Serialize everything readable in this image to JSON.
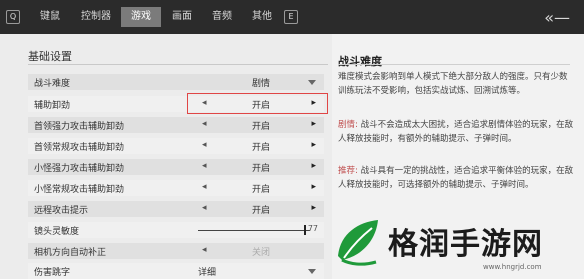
{
  "topbar": {
    "tabs": [
      {
        "label": "键鼠"
      },
      {
        "label": "控制器"
      },
      {
        "label": "游戏"
      },
      {
        "label": "画面"
      },
      {
        "label": "音频"
      },
      {
        "label": "其他"
      }
    ],
    "left_key": "Q",
    "right_key": "E"
  },
  "left": {
    "section_title": "基础设置",
    "rows": [
      {
        "label": "战斗难度",
        "value": "剧情"
      },
      {
        "label": "辅助卸劲",
        "value": "开启"
      },
      {
        "label": "首领强力攻击辅助卸劲",
        "value": "开启"
      },
      {
        "label": "首领常规攻击辅助卸劲",
        "value": "开启"
      },
      {
        "label": "小怪强力攻击辅助卸劲",
        "value": "开启"
      },
      {
        "label": "小怪常规攻击辅助卸劲",
        "value": "开启"
      },
      {
        "label": "远程攻击提示",
        "value": "开启"
      },
      {
        "label": "镜头灵敏度",
        "value": "77"
      },
      {
        "label": "相机方向自动补正",
        "value": "关闭"
      },
      {
        "label": "伤害跳字",
        "value": "详细"
      }
    ]
  },
  "right": {
    "title": "战斗难度",
    "p1": "难度模式会影响到单人模式下绝大部分敌人的强度。只有少数训练玩法不受影响，包括实战试炼、回溯试炼等。",
    "p2_head": "剧情:",
    "p2": " 战斗不会造成太大困扰，适合追求剧情体验的玩家，在敌人释放技能时，有额外的辅助提示、子弹时间。",
    "p3_head": "推荐:",
    "p3": " 战斗具有一定的挑战性，适合追求平衡体验的玩家，在敌人释放技能时，可选择额外的辅助提示、子弹时间。"
  },
  "watermark": {
    "text": "格润手游网",
    "url": "www.hngrjd.com"
  }
}
